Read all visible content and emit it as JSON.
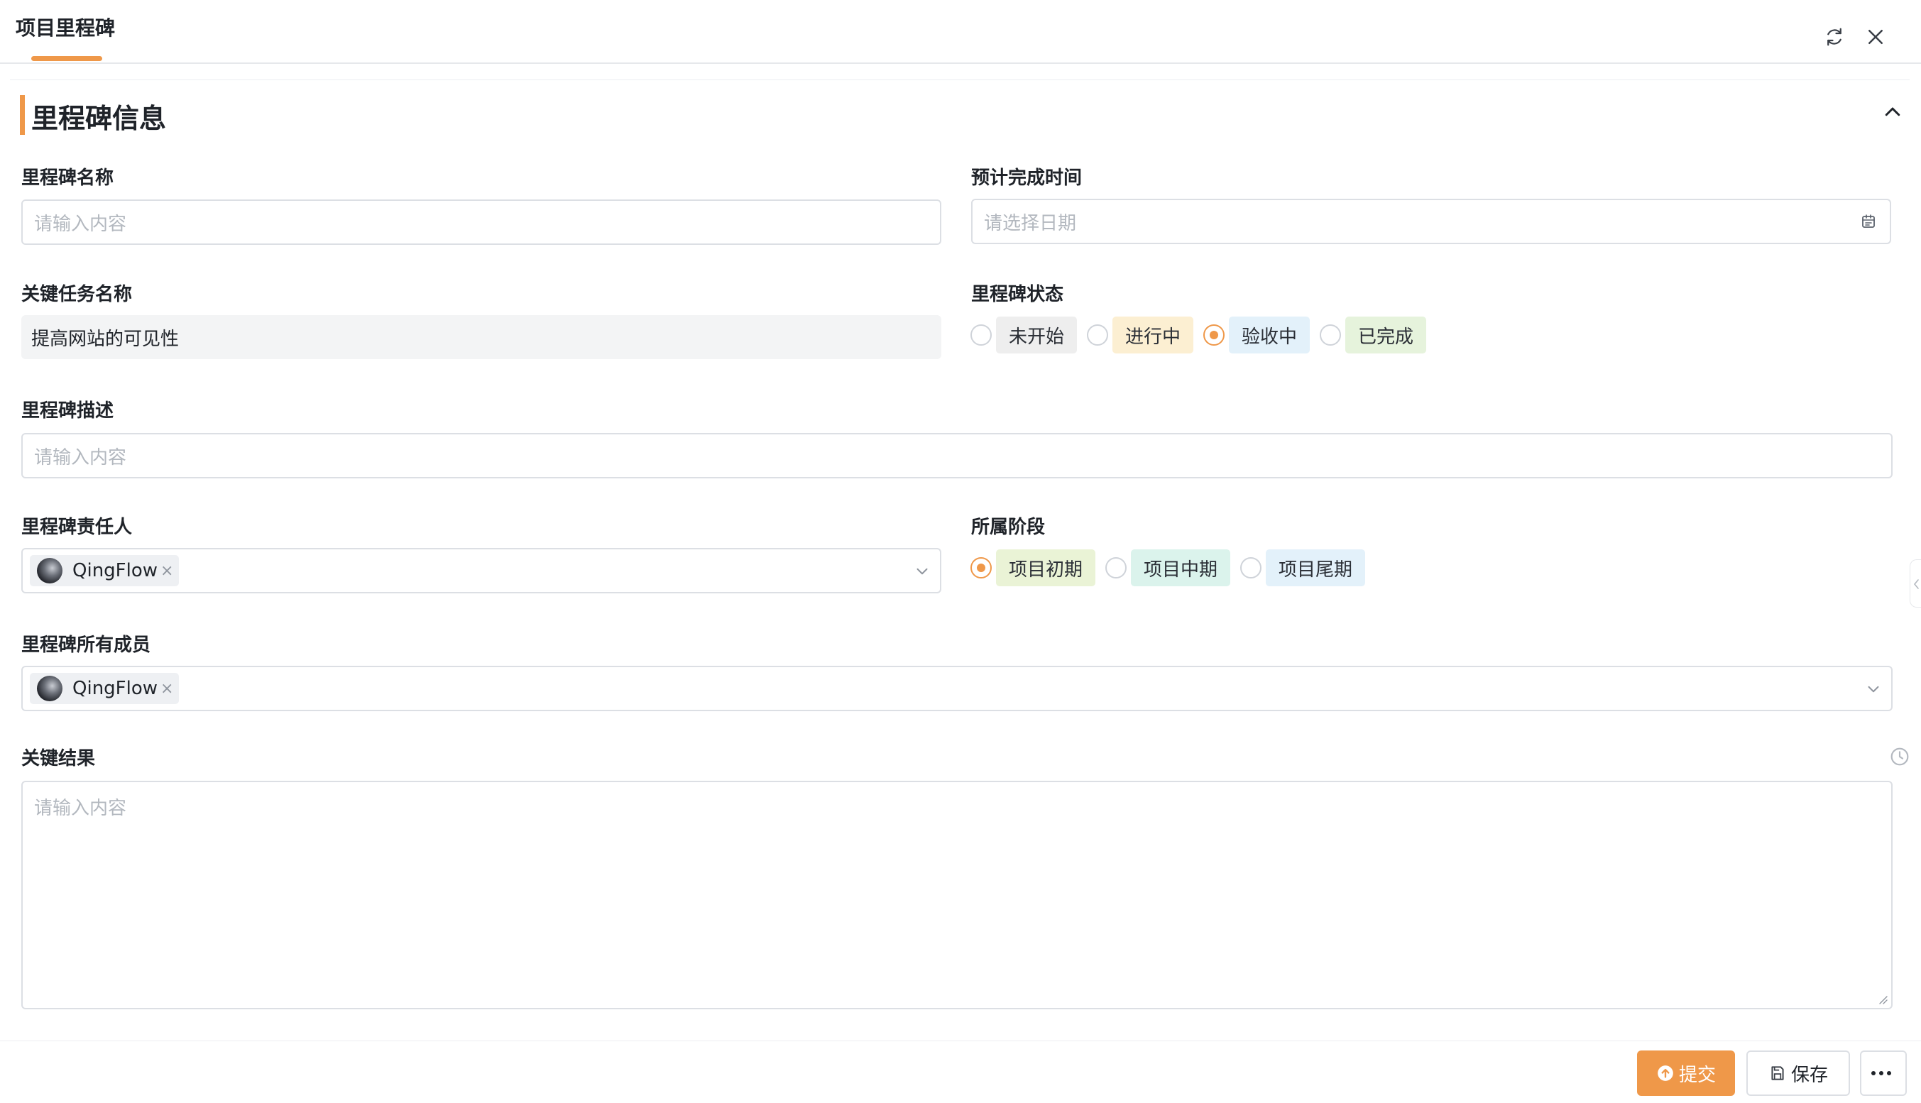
{
  "header": {
    "tab_title": "项目里程碑",
    "refresh_icon": "refresh-icon",
    "close_icon": "close-icon"
  },
  "section": {
    "title": "里程碑信息",
    "collapse_icon": "chevron-up-icon"
  },
  "fields": {
    "milestone_name": {
      "label": "里程碑名称",
      "placeholder": "请输入内容"
    },
    "due_date": {
      "label": "预计完成时间",
      "placeholder": "请选择日期"
    },
    "key_task": {
      "label": "关键任务名称",
      "value": "提高网站的可见性"
    },
    "status": {
      "label": "里程碑状态",
      "options": [
        {
          "label": "未开始",
          "checked": false,
          "color": "#eeeeee"
        },
        {
          "label": "进行中",
          "checked": false,
          "color": "#fcefd2"
        },
        {
          "label": "验收中",
          "checked": true,
          "color": "#e3f1fa"
        },
        {
          "label": "已完成",
          "checked": false,
          "color": "#e6f3dc"
        }
      ]
    },
    "description": {
      "label": "里程碑描述",
      "placeholder": "请输入内容"
    },
    "owner": {
      "label": "里程碑责任人",
      "member": "QingFlow",
      "remove": "×"
    },
    "stage": {
      "label": "所属阶段",
      "options": [
        {
          "label": "项目初期",
          "checked": true,
          "color": "#eaf3d6"
        },
        {
          "label": "项目中期",
          "checked": false,
          "color": "#dbf3ec"
        },
        {
          "label": "项目尾期",
          "checked": false,
          "color": "#e3f1fa"
        }
      ]
    },
    "members": {
      "label": "里程碑所有成员",
      "member": "QingFlow",
      "remove": "×"
    },
    "key_result": {
      "label": "关键结果",
      "placeholder": "请输入内容"
    }
  },
  "footer": {
    "submit_label": "提交",
    "save_label": "保存",
    "more_icon": "more-icon"
  },
  "colors": {
    "accent": "#ef9849",
    "border": "#dcdfe4"
  }
}
